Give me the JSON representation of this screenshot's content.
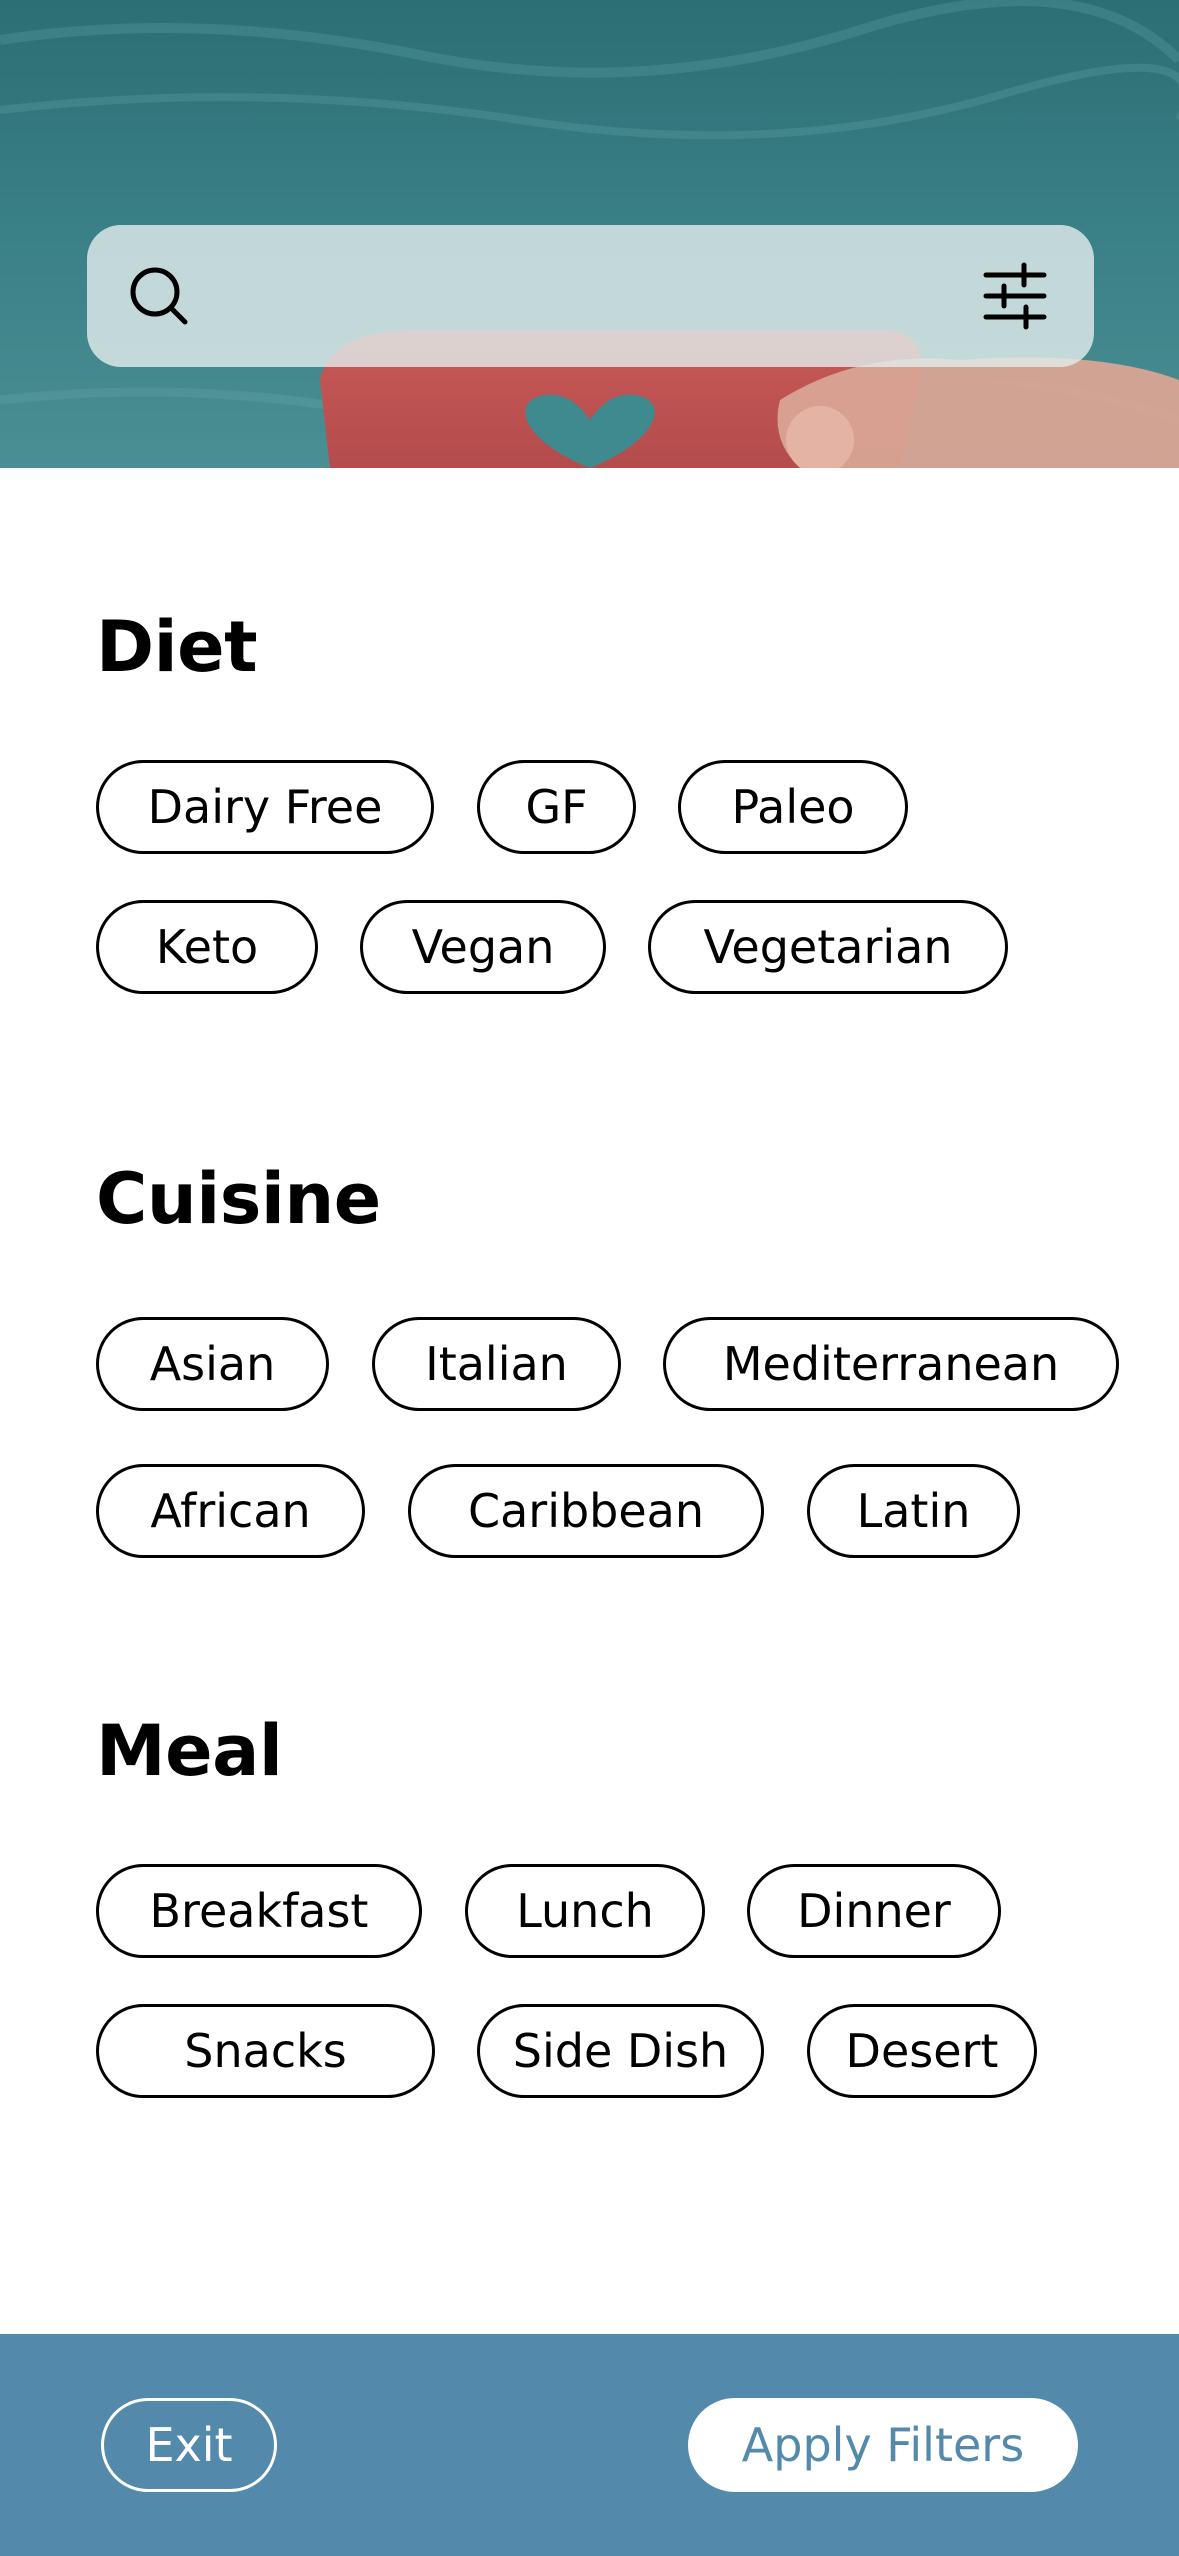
{
  "search": {
    "search_icon": "search-icon",
    "filter_icon": "sliders-icon",
    "value": ""
  },
  "sections": {
    "diet": {
      "title": "Diet",
      "chips": [
        "Dairy Free",
        "GF",
        "Paleo",
        "Keto",
        "Vegan",
        "Vegetarian"
      ]
    },
    "cuisine": {
      "title": "Cuisine",
      "chips": [
        "Asian",
        "Italian",
        "Mediterranean",
        "African",
        "Caribbean",
        "Latin"
      ]
    },
    "meal": {
      "title": "Meal",
      "chips": [
        "Breakfast",
        "Lunch",
        "Dinner",
        "Snacks",
        "Side Dish",
        "Desert"
      ]
    }
  },
  "footer": {
    "exit_label": "Exit",
    "apply_label": "Apply Filters"
  },
  "colors": {
    "accent": "#538aab",
    "chip_border": "#000000",
    "background": "#ffffff"
  }
}
